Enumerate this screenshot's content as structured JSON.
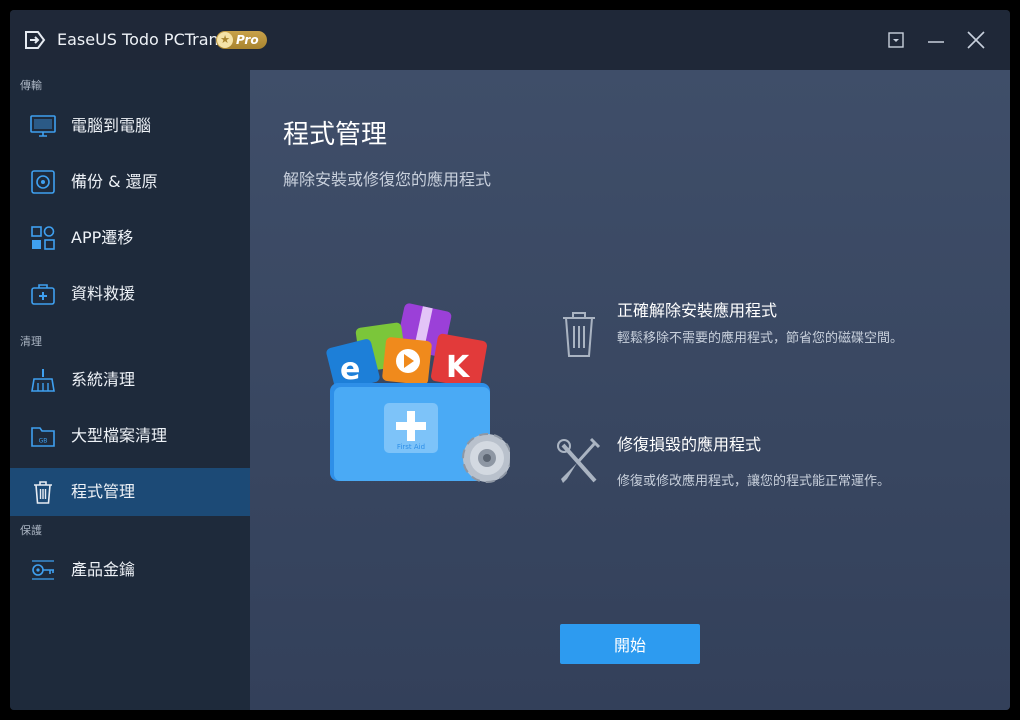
{
  "window": {
    "app_name": "EaseUS Todo PCTrans",
    "badge": "Pro",
    "badge_star": "★",
    "colors": {
      "accent": "#2d9bf0",
      "sidebar_active": "#1c4a76",
      "badge_gold": "#c9a24a"
    }
  },
  "sidebar": {
    "sections": [
      {
        "label": "傳輸"
      },
      {
        "label": "清理"
      },
      {
        "label": "保護"
      }
    ],
    "items": [
      {
        "label": "電腦到電腦",
        "icon": "computer-icon"
      },
      {
        "label": "備份 & 還原",
        "icon": "backup-restore-icon"
      },
      {
        "label": "APP遷移",
        "icon": "app-migration-icon"
      },
      {
        "label": "資料救援",
        "icon": "data-rescue-icon"
      },
      {
        "label": "系統清理",
        "icon": "system-cleanup-icon"
      },
      {
        "label": "大型檔案清理",
        "icon": "large-file-cleanup-icon"
      },
      {
        "label": "程式管理",
        "icon": "trash-icon",
        "active": true
      },
      {
        "label": "產品金鑰",
        "icon": "product-key-icon"
      }
    ]
  },
  "main": {
    "title": "程式管理",
    "subtitle": "解除安裝或修復您的應用程式",
    "hero_labels": {
      "first_aid": "First Aid",
      "k_letter": "K"
    },
    "features": [
      {
        "title": "正確解除安裝應用程式",
        "description": "輕鬆移除不需要的應用程式，節省您的磁碟空間。",
        "icon": "trash-icon"
      },
      {
        "title": "修復損毀的應用程式",
        "description": "修復或修改應用程式，讓您的程式能正常運作。",
        "icon": "repair-tools-icon"
      }
    ],
    "start_label": "開始"
  }
}
